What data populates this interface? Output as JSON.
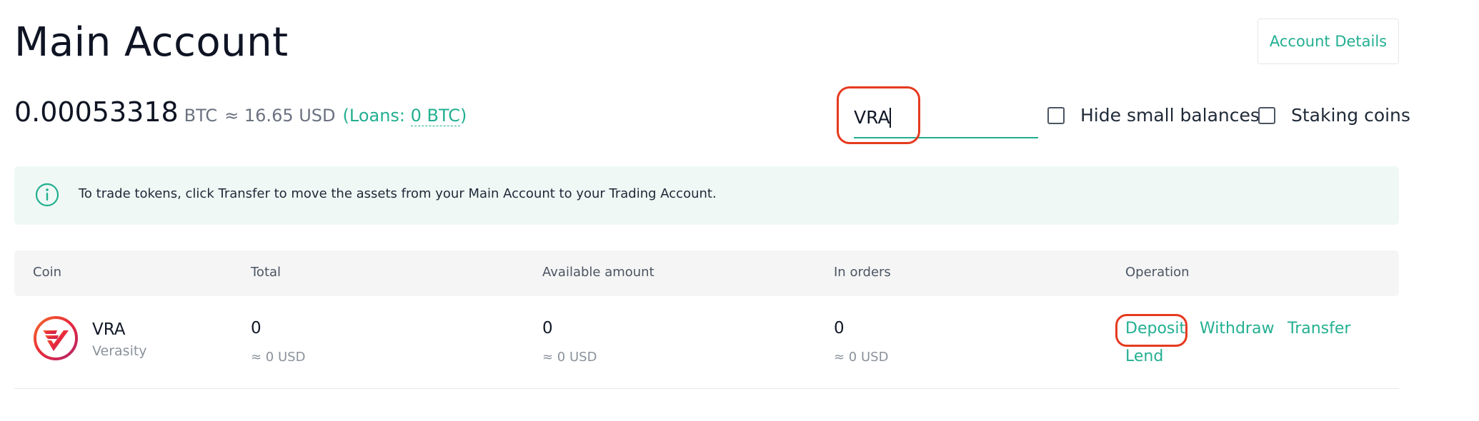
{
  "header": {
    "title": "Main Account",
    "account_details_label": "Account Details"
  },
  "balance": {
    "amount": "0.00053318",
    "unit": "BTC",
    "approx": "≈ 16.65 USD",
    "loans_prefix": "(Loans: ",
    "loans_value": "0 BTC",
    "loans_suffix": ")"
  },
  "search": {
    "value": "VRA",
    "placeholder": ""
  },
  "filters": {
    "hide_small_label": "Hide small balances",
    "hide_small_checked": false,
    "staking_label": "Staking coins",
    "staking_checked": false
  },
  "info": {
    "icon": "info-circle-icon",
    "text": "To trade tokens, click Transfer to move the assets from your Main Account to your Trading Account."
  },
  "table": {
    "headers": [
      "Coin",
      "Total",
      "Available amount",
      "In orders",
      "Operation"
    ],
    "rows": [
      {
        "icon": "verasity-logo-icon",
        "symbol": "VRA",
        "name": "Verasity",
        "total": "0",
        "total_usd": "≈ 0 USD",
        "available": "0",
        "available_usd": "≈ 0 USD",
        "in_orders": "0",
        "in_orders_usd": "≈ 0 USD",
        "operations": [
          "Deposit",
          "Withdraw",
          "Transfer",
          "Lend"
        ]
      }
    ]
  },
  "colors": {
    "accent": "#23af91",
    "highlight": "#e53a1f",
    "banner_bg": "#eff8f5",
    "header_bg": "#f5f5f5"
  }
}
